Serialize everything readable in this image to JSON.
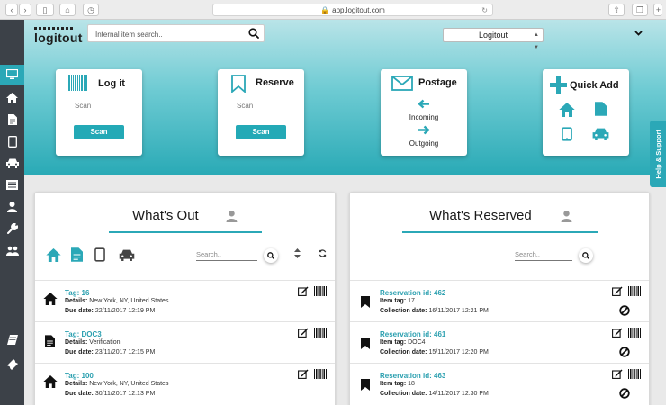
{
  "browser": {
    "url": "app.logitout.com"
  },
  "header": {
    "logo_text": "logitout",
    "search_placeholder": "Internal item search..",
    "user_select": "Logitout"
  },
  "actions": {
    "logit": {
      "title": "Log it",
      "placeholder": "Scan",
      "button": "Scan"
    },
    "reserve": {
      "title": "Reserve",
      "placeholder": "Scan",
      "button": "Scan"
    },
    "postage": {
      "title": "Postage",
      "incoming": "Incoming",
      "outgoing": "Outgoing"
    },
    "quickadd": {
      "title": "Quick Add"
    }
  },
  "help_support": "Help & Support",
  "whats_out": {
    "title": "What's Out",
    "search_placeholder": "Search..",
    "details_label": "Details:",
    "due_label": "Due date:",
    "items": [
      {
        "icon": "house-icon",
        "tag": "Tag: 16",
        "details": "New York, NY, United States",
        "due": "22/11/2017 12:19 PM"
      },
      {
        "icon": "document-icon",
        "tag": "Tag: DOC3",
        "details": "Verification",
        "due": "23/11/2017 12:15 PM"
      },
      {
        "icon": "house-icon",
        "tag": "Tag: 100",
        "details": "New York, NY, United States",
        "due": "30/11/2017 12:13 PM"
      }
    ]
  },
  "whats_reserved": {
    "title": "What's Reserved",
    "search_placeholder": "Search..",
    "tag_label": "Item tag:",
    "collection_label": "Collection date:",
    "items": [
      {
        "reservation": "Reservation id: 462",
        "tag": "17",
        "collection": "16/11/2017 12:21 PM"
      },
      {
        "reservation": "Reservation id: 461",
        "tag": "DOC4",
        "collection": "15/11/2017 12:20 PM"
      },
      {
        "reservation": "Reservation id: 463",
        "tag": "18",
        "collection": "14/11/2017 12:30 PM"
      }
    ]
  },
  "colors": {
    "accent": "#2ba8b7",
    "sidebar": "#3c4148"
  }
}
